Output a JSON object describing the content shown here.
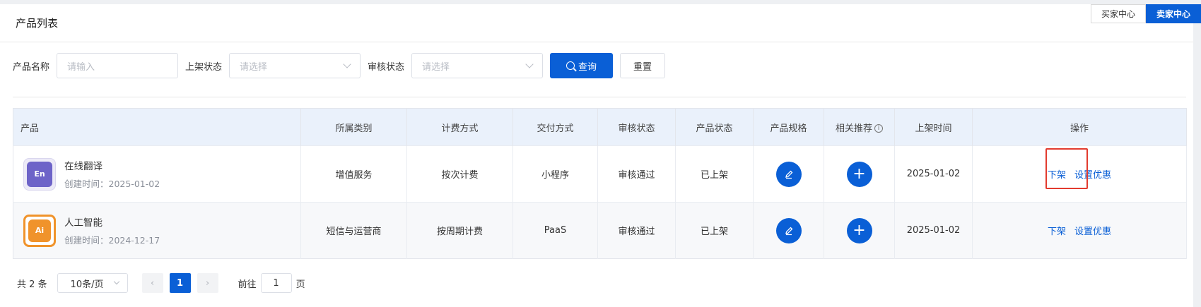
{
  "header": {
    "title": "产品列表"
  },
  "role_switch": {
    "buyer": "买家中心",
    "seller": "卖家中心"
  },
  "filters": {
    "name_label": "产品名称",
    "name_placeholder": "请输入",
    "listing_label": "上架状态",
    "listing_placeholder": "请选择",
    "review_label": "审核状态",
    "review_placeholder": "请选择",
    "query_label": "查询",
    "reset_label": "重置"
  },
  "table": {
    "columns": [
      "产品",
      "所属类别",
      "计费方式",
      "交付方式",
      "审核状态",
      "产品状态",
      "产品规格",
      "相关推荐",
      "上架时间",
      "操作"
    ],
    "rows": [
      {
        "name": "在线翻译",
        "created": "创建时间：2025-01-02",
        "category": "增值服务",
        "billing": "按次计费",
        "delivery": "小程序",
        "review": "审核通过",
        "status": "已上架",
        "listed": "2025-01-02",
        "action1": "下架",
        "action2": "设置优惠",
        "logo_text": "En",
        "logo_color": "#6d63c8"
      },
      {
        "name": "人工智能",
        "created": "创建时间：2024-12-17",
        "category": "短信与运营商",
        "billing": "按周期计费",
        "delivery": "PaaS",
        "review": "审核通过",
        "status": "已上架",
        "listed": "2025-01-02",
        "action1": "下架",
        "action2": "设置优惠",
        "logo_text": "Ai",
        "logo_color": "#f0932b"
      }
    ]
  },
  "pagination": {
    "total": "共 2 条",
    "page_size": "10条/页",
    "current_page": "1",
    "goto_label": "前往",
    "goto_value": "1",
    "page_suffix": "页"
  },
  "colors": {
    "primary": "#0a5fd6",
    "success": "#3aa63a",
    "highlight": "#e23b2e"
  }
}
